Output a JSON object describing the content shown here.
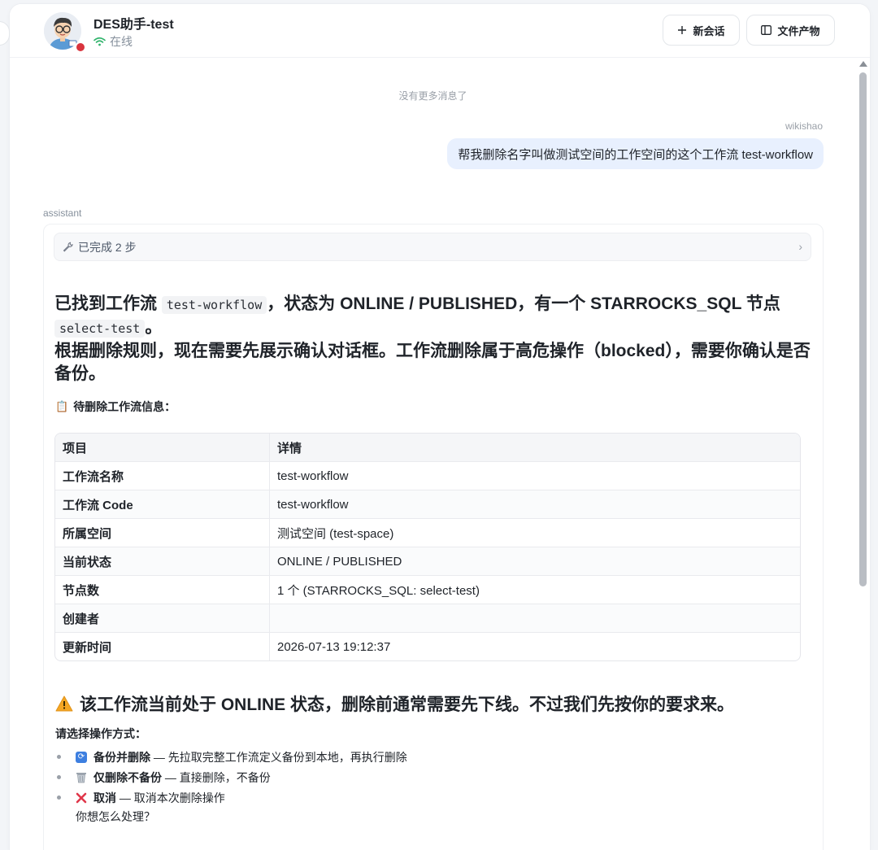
{
  "header": {
    "bot_name": "DES助手-test",
    "status": "在线",
    "new_chat_label": "新会话",
    "files_label": "文件产物"
  },
  "messages": {
    "no_more": "没有更多消息了",
    "user_name": "wikishao",
    "user_text": "帮我删除名字叫做测试空间的工作空间的这个工作流 test-workflow",
    "assistant_label": "assistant"
  },
  "reply": {
    "steps_label": "已完成 2 步",
    "line1_pre": "已找到工作流 ",
    "line1_code": "test-workflow",
    "line1_post": "，状态为 ONLINE / PUBLISHED，有一个 STARROCKS_SQL 节点",
    "line2_code": "select-test",
    "line2_post": "。",
    "line3": "根据删除规则，现在需要先展示确认对话框。工作流删除属于高危操作（blocked），需要你确认是否备份。",
    "info_title": "待删除工作流信息：",
    "table": {
      "headers": [
        "项目",
        "详情"
      ],
      "rows": [
        [
          "工作流名称",
          "test-workflow"
        ],
        [
          "工作流 Code",
          "test-workflow"
        ],
        [
          "所属空间",
          "测试空间 (test-space)"
        ],
        [
          "当前状态",
          "ONLINE / PUBLISHED"
        ],
        [
          "节点数",
          "1 个 (STARROCKS_SQL: select-test)"
        ],
        [
          "创建者",
          ""
        ],
        [
          "更新时间",
          "2026-07-13 19:12:37"
        ]
      ]
    },
    "warning": "该工作流当前处于 ONLINE 状态，删除前通常需要先下线。不过我们先按你的要求来。",
    "choose_label": "请选择操作方式：",
    "options": [
      {
        "icon": "🔄",
        "title": "备份并删除",
        "desc": " — 先拉取完整工作流定义备份到本地，再执行删除"
      },
      {
        "icon": "🗑",
        "title": "仅删除不备份",
        "desc": " — 直接删除，不备份"
      },
      {
        "icon": "❌",
        "title": "取消",
        "desc": " — 取消本次删除操作"
      }
    ],
    "question": "你想怎么处理？"
  },
  "colors": {
    "online": "#2fb36b",
    "user_bubble": "#e8f0fe",
    "warning": "#f5a623"
  }
}
